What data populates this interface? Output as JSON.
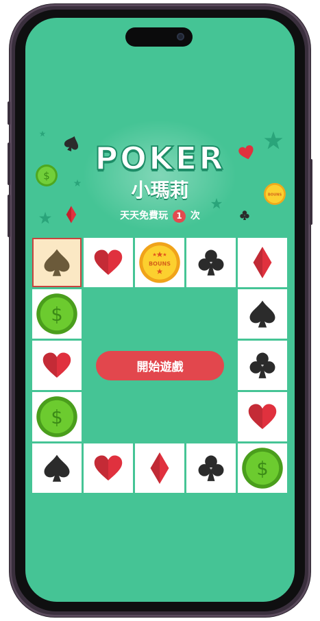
{
  "header": {
    "title": "POKER",
    "subtitle": "小瑪莉",
    "tagline_pre": "天天免費玩",
    "tagline_count": "1",
    "tagline_post": "次"
  },
  "coin_label": "BOUNS",
  "dollar_symbol": "$",
  "start_button_label": "開始遊戲",
  "colors": {
    "background": "#45c495",
    "red": "#e0313e",
    "black": "#2b2b2b",
    "gold": "#f6c21c",
    "green_coin": "#62c32b",
    "button": "#e2474d"
  },
  "board": {
    "active_index": 0,
    "cells": [
      {
        "icon": "spade"
      },
      {
        "icon": "heart"
      },
      {
        "icon": "bonus-coin"
      },
      {
        "icon": "club"
      },
      {
        "icon": "diamond"
      },
      {
        "icon": "dollar-coin"
      },
      {
        "icon": "spade"
      },
      {
        "icon": "heart"
      },
      {
        "icon": "club"
      },
      {
        "icon": "dollar-coin"
      },
      {
        "icon": "heart"
      },
      {
        "icon": "spade"
      },
      {
        "icon": "heart"
      },
      {
        "icon": "diamond"
      },
      {
        "icon": "club"
      },
      {
        "icon": "dollar-coin"
      }
    ]
  }
}
